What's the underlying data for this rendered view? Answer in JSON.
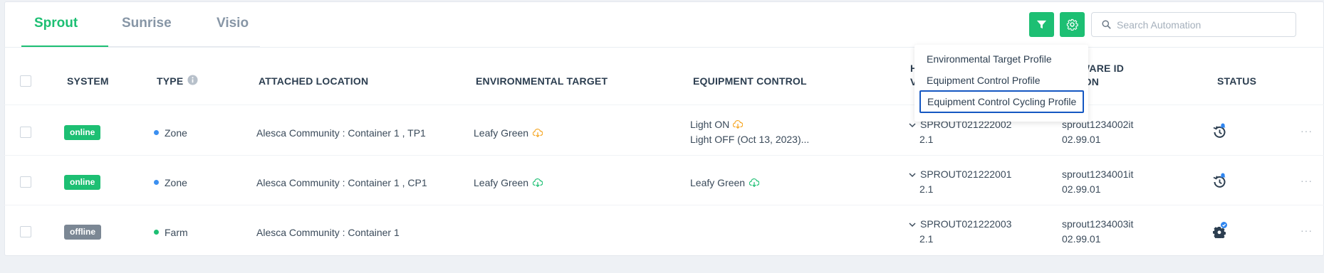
{
  "tabs": [
    {
      "label": "Sprout",
      "active": true
    },
    {
      "label": "Sunrise",
      "active": false
    },
    {
      "label": "Visio",
      "active": false
    }
  ],
  "toolbar": {
    "filter_icon": "filter-icon",
    "settings_icon": "gear-icon",
    "search_placeholder": "Search Automation",
    "search_value": ""
  },
  "columns": {
    "system": "SYSTEM",
    "type": "TYPE",
    "attached_location": "ATTACHED LOCATION",
    "environmental_target": "ENVIRONMENTAL TARGET",
    "equipment_control": "EQUIPMENT CONTROL",
    "hardware_id_partial_1": "H",
    "hardware_id_partial_2": "V",
    "firmware_id_partial_1": "TWARE ID",
    "firmware_id_partial_2": "SION",
    "status": "STATUS"
  },
  "column_menu": {
    "items": [
      "Environmental Target Profile",
      "Equipment Control Profile",
      "Equipment Control Cycling Profile"
    ],
    "selected_index": 2
  },
  "rows": [
    {
      "system": "online",
      "type": "Zone",
      "type_color": "#3b8ff0",
      "location": "Alesca Community : Container 1 , TP1",
      "env_target": "Leafy Green",
      "env_icon_color": "#f5a623",
      "equip_line1": "Light ON",
      "equip_line2": "Light OFF (Oct 13, 2023)...",
      "equip_icon_color": "#f5a623",
      "hw_line1": "SPROUT021222002",
      "hw_line2": "2.1",
      "fw_line1": "sprout1234002it",
      "fw_line2": "02.99.01",
      "status_icon": "history-icon"
    },
    {
      "system": "online",
      "type": "Zone",
      "type_color": "#3b8ff0",
      "location": "Alesca Community : Container 1 , CP1",
      "env_target": "Leafy Green",
      "env_icon_color": "#1dbf73",
      "equip_line1": "Leafy Green",
      "equip_line2": "",
      "equip_icon_color": "#1dbf73",
      "hw_line1": "SPROUT021222001",
      "hw_line2": "2.1",
      "fw_line1": "sprout1234001it",
      "fw_line2": "02.99.01",
      "status_icon": "history-icon"
    },
    {
      "system": "offline",
      "type": "Farm",
      "type_color": "#1dbf73",
      "location": "Alesca Community : Container 1",
      "env_target": "",
      "env_icon_color": "",
      "equip_line1": "",
      "equip_line2": "",
      "equip_icon_color": "",
      "hw_line1": "SPROUT021222003",
      "hw_line2": "2.1",
      "fw_line1": "sprout1234003it",
      "fw_line2": "02.99.01",
      "status_icon": "gear-icon"
    }
  ],
  "colors": {
    "accent": "#1dbf73",
    "offline": "#7b8794",
    "selection_border": "#1457c2",
    "notify_blue": "#2f86f0"
  }
}
